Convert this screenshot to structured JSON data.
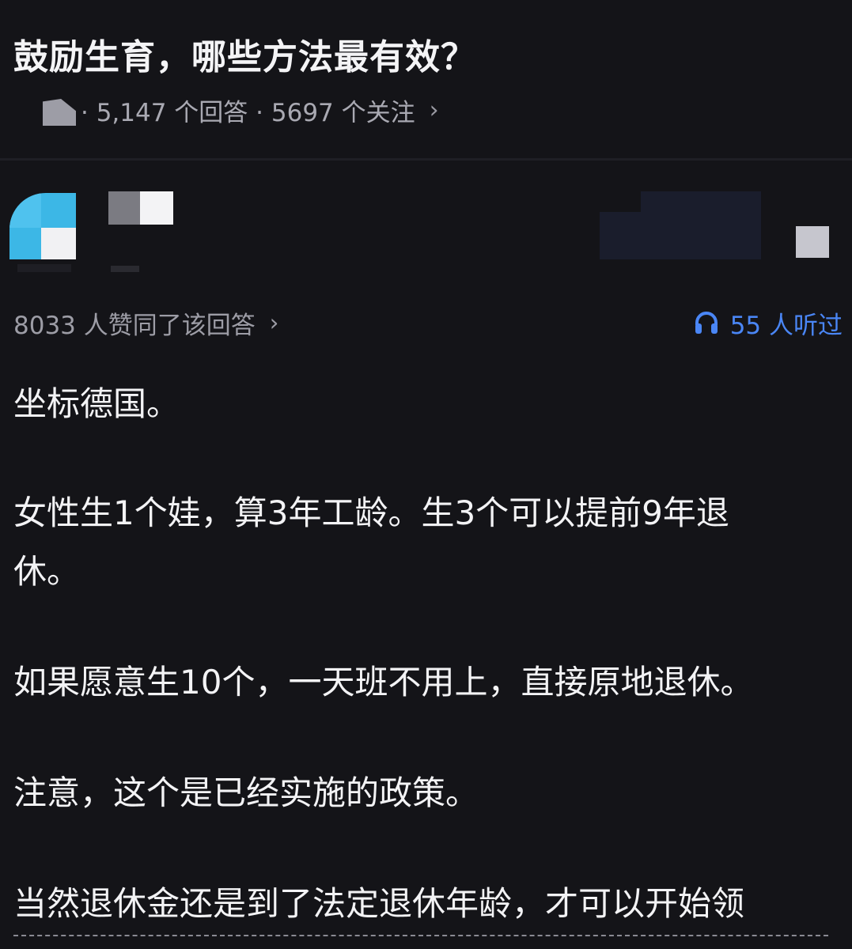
{
  "question": {
    "title": "鼓励生育，哪些方法最有效？",
    "meta": "· 5,147 个回答 · 5697 个关注",
    "chevron": "›",
    "topic_icon": "topic-icon"
  },
  "answer": {
    "upvotes": "8033 人赞同了该回答",
    "upvotes_chevron": "›",
    "listen_icon": "headphones-icon",
    "listen_text": "55 人听过",
    "paragraphs": [
      "坐标德国。",
      "女性生1个娃，算3年工龄。生3个可以提前9年退\n休。",
      "如果愿意生10个，一天班不用上，直接原地退休。",
      "注意，这个是已经实施的政策。",
      "当然退休金还是到了法定退休年龄，才可以开始领"
    ]
  },
  "colors": {
    "background": "#141418",
    "accent_blue": "#4a86f5",
    "avatar_blue": "#3cb7e6",
    "text_primary": "#f3f3f5",
    "text_secondary": "#9d9da6"
  }
}
